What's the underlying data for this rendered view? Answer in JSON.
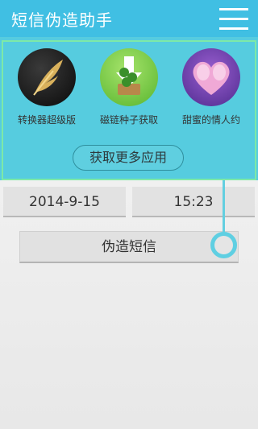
{
  "actionbar": {
    "title": "短信伪造助手",
    "menu_icon": "hamburger-menu-icon",
    "color": "#40bfe3"
  },
  "promo": {
    "background": "#56ccdf",
    "border_color": "#7de9a8",
    "apps": [
      {
        "label": "转换器超级版",
        "icon": "feather-quill-icon"
      },
      {
        "label": "磁链种子获取",
        "icon": "download-arrow-icon"
      },
      {
        "label": "甜蜜的情人约",
        "icon": "heart-icon"
      }
    ],
    "more_label": "获取更多应用"
  },
  "form": {
    "date": "2014-9-15",
    "time": "15:23",
    "submit_label": "伪造短信"
  }
}
